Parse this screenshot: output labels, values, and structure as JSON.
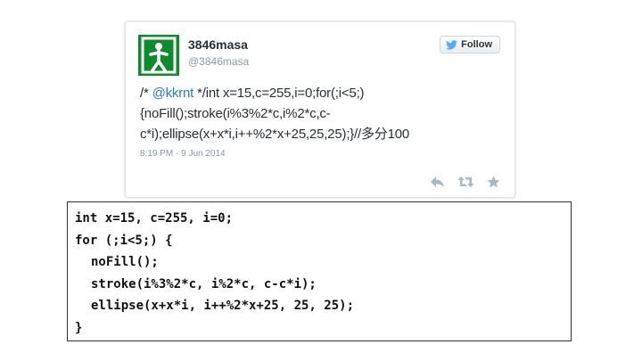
{
  "tweet": {
    "user_name": "3846masa",
    "user_handle": "@3846masa",
    "follow_label": "Follow",
    "text_prefix": "/* ",
    "mention": "@kkrnt",
    "text_body": " */int x=15,c=255,i=0;for(;i<5;)\n{noFill();stroke(i%3%2*c,i%2*c,c-\nc*i);ellipse(x+x*i,i++%2*x+25,25,25);}//多分100",
    "timestamp": "8:19 PM - 9 Jun 2014",
    "colors": {
      "mention": "#2b7bb9",
      "avatar": "#0f8a2e",
      "twitter_bird": "#55acee",
      "action_icons": "#aab8c2"
    },
    "icons": [
      "twitter-bird-icon",
      "reply-icon",
      "retweet-icon",
      "favorite-star-icon"
    ]
  },
  "code": {
    "lines": [
      "int x=15, c=255, i=0;",
      "for (;i<5;) {",
      "noFill();",
      "stroke(i%3%2*c, i%2*c, c-c*i);",
      "ellipse(x+x*i, i++%2*x+25, 25, 25);",
      "}"
    ]
  }
}
